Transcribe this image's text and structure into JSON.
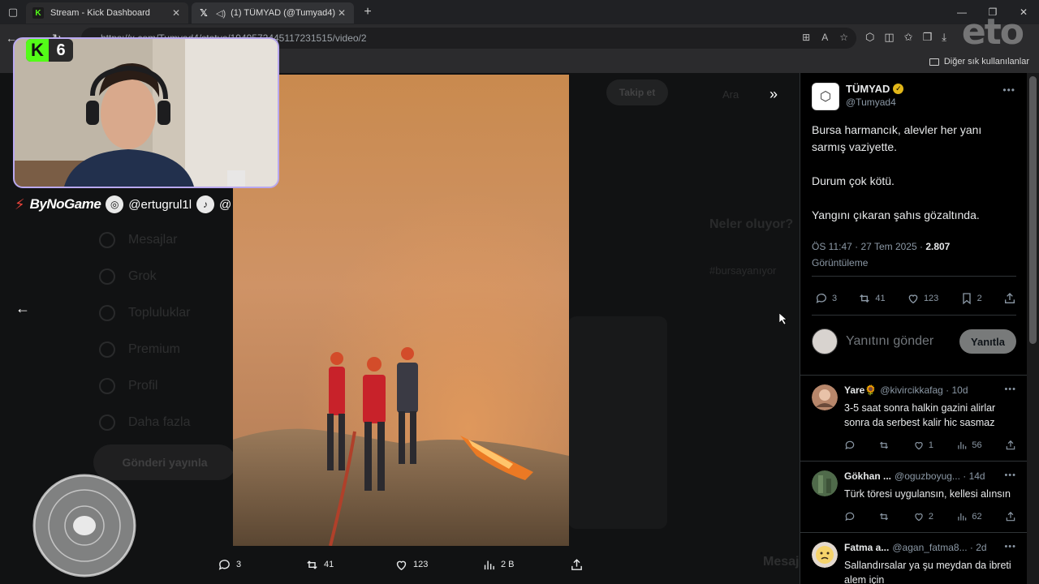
{
  "browser": {
    "tabs": [
      {
        "title": "Stream - Kick Dashboard",
        "active": false
      },
      {
        "title": "(1) TÜMYAD (@Tumyad4) / X",
        "active": true
      }
    ],
    "url": "https://x.com/Tumyad4/status/1949572445117231515/video/2",
    "bookmark_other": "Diğer sık kullanılanlar",
    "watermark": "eto"
  },
  "overlay": {
    "kick_number": "6",
    "brand": "ByNoGame",
    "instagram": "@ertugrul1l",
    "tiktok": "@"
  },
  "background": {
    "subscribe": "Takip et",
    "search": "Ara",
    "nav": [
      "Mesajlar",
      "Grok",
      "Topluluklar",
      "Premium",
      "Profil",
      "Daha fazla"
    ],
    "post_btn": "Gönderi yayınla",
    "trending_title": "Neler oluyor?",
    "trend": "#bursayanıyor",
    "messages": "Mesajlar"
  },
  "video_actions": {
    "replies": "3",
    "reposts": "41",
    "likes": "123",
    "views": "2 B"
  },
  "tweet": {
    "author": "TÜMYAD",
    "handle": "@Tumyad4",
    "lines": [
      "Bursa harmancık, alevler her yanı sarmış  vaziyette.",
      "Durum  çok kötü.",
      "Yangını çıkaran şahıs gözaltında."
    ],
    "time": "ÖS 11:47 · 27 Tem 2025 ·",
    "views": "2.807",
    "views_label": "Görüntüleme",
    "stats": {
      "replies": "3",
      "reposts": "41",
      "likes": "123",
      "bookmarks": "2"
    },
    "reply_placeholder": "Yanıtını gönder",
    "reply_button": "Yanıtla"
  },
  "replies": [
    {
      "name": "Yare🌻",
      "handle": "@kivircikkafag · 10d",
      "text": "3-5 saat sonra halkin gazini alirlar sonra da serbest kalir hic sasmaz",
      "likes": "1",
      "views": "56"
    },
    {
      "name": "Gökhan ...",
      "handle": "@oguzboyug... · 14d",
      "text": "Türk töresi uygulansın, kellesi alınsın",
      "likes": "2",
      "views": "62"
    },
    {
      "name": "Fatma a...",
      "handle": "@agan_fatma8... · 2d",
      "text": "Sallandırsalar ya şu meydan da ibreti alem için"
    }
  ],
  "colors": {
    "kick_green": "#53fc18",
    "verified_gold": "#e2b719",
    "webcam_border": "#b9a8f0"
  }
}
